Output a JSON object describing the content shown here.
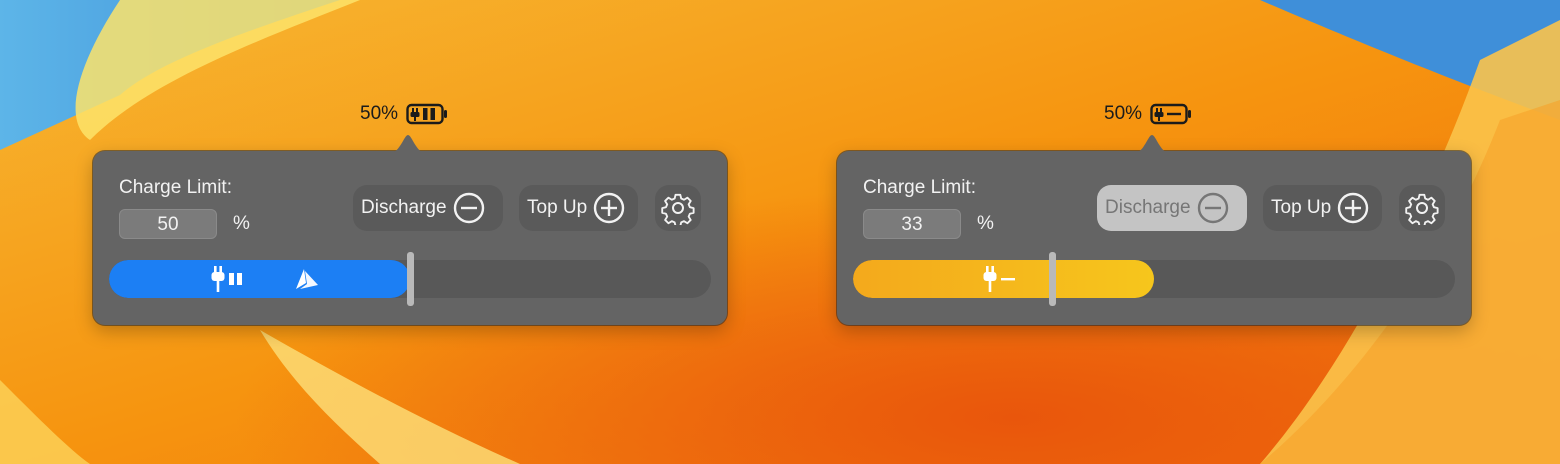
{
  "colors": {
    "accent_blue": "#1c7ff4",
    "accent_yellow": "#f6c61c",
    "popover_bg": "#646464"
  },
  "left": {
    "menubar": {
      "percent": "50%",
      "icon": "battery-plug-paused-icon"
    },
    "charge_limit_label": "Charge Limit:",
    "limit_value": "50",
    "percent_sign": "%",
    "discharge_label": "Discharge",
    "topup_label": "Top Up",
    "discharge_active": false,
    "bar": {
      "fill_percent": 50,
      "limit_percent": 50,
      "color": "blue",
      "icons": [
        "plug-icon",
        "pause-icon",
        "sailing-icon"
      ]
    }
  },
  "right": {
    "menubar": {
      "percent": "50%",
      "icon": "battery-plug-minus-icon"
    },
    "charge_limit_label": "Charge Limit:",
    "limit_value": "33",
    "percent_sign": "%",
    "discharge_label": "Discharge",
    "topup_label": "Top Up",
    "discharge_active": true,
    "bar": {
      "fill_percent": 50,
      "limit_percent": 33,
      "color": "yellow",
      "icons": [
        "plug-icon",
        "minus-icon"
      ]
    }
  }
}
